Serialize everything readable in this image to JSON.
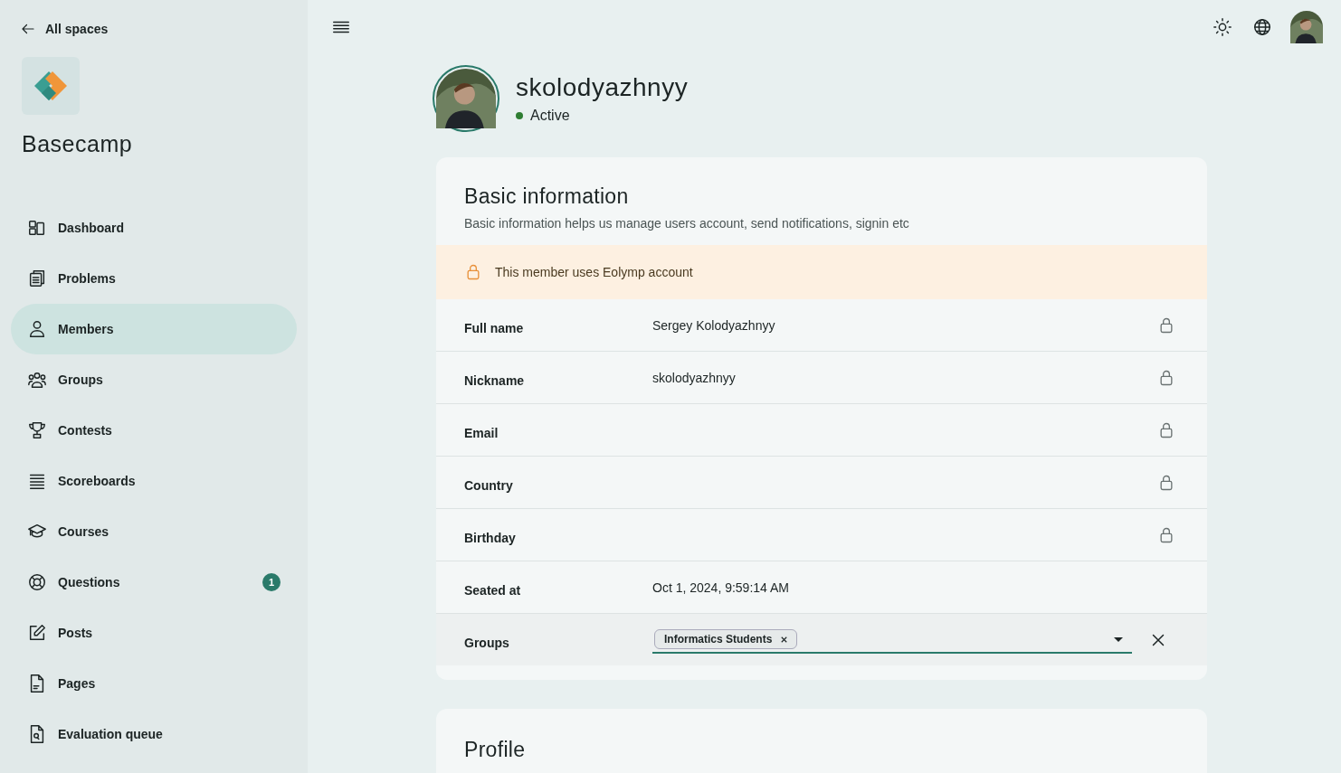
{
  "sidebar": {
    "back_link": "All spaces",
    "space_name": "Basecamp",
    "items": [
      {
        "label": "Dashboard",
        "selected": false
      },
      {
        "label": "Problems",
        "selected": false
      },
      {
        "label": "Members",
        "selected": true
      },
      {
        "label": "Groups",
        "selected": false
      },
      {
        "label": "Contests",
        "selected": false
      },
      {
        "label": "Scoreboards",
        "selected": false
      },
      {
        "label": "Courses",
        "selected": false
      },
      {
        "label": "Questions",
        "selected": false,
        "badge": "1"
      },
      {
        "label": "Posts",
        "selected": false
      },
      {
        "label": "Pages",
        "selected": false
      },
      {
        "label": "Evaluation queue",
        "selected": false
      }
    ]
  },
  "profile": {
    "username": "skolodyazhnyy",
    "status": "Active"
  },
  "basic_info": {
    "title": "Basic information",
    "subtitle": "Basic information helps us manage users account, send notifications, signin etc",
    "notice": "This member uses Eolymp account",
    "fields": [
      {
        "kind": "locked",
        "label": "Full name",
        "value": "Sergey Kolodyazhnyy"
      },
      {
        "kind": "locked",
        "label": "Nickname",
        "value": "skolodyazhnyy"
      },
      {
        "kind": "locked",
        "label": "Email"
      },
      {
        "kind": "locked",
        "label": "Country"
      },
      {
        "kind": "locked",
        "label": "Birthday"
      },
      {
        "kind": "plain",
        "label": "Seated at",
        "value": "Oct 1, 2024, 9:59:14 AM"
      },
      {
        "kind": "select",
        "label": "Groups",
        "chips": [
          "Informatics Students"
        ]
      }
    ]
  },
  "profile_card": {
    "title": "Profile"
  }
}
